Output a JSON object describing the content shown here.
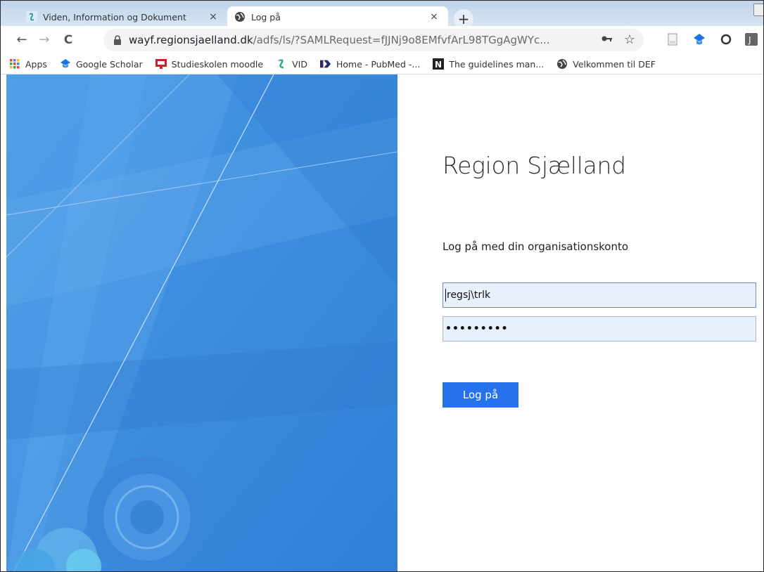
{
  "browser": {
    "tabs": [
      {
        "title": "Viden, Information og Dokument",
        "close": "×",
        "active": false
      },
      {
        "title": "Log på",
        "close": "×",
        "active": true
      }
    ],
    "new_tab": "+",
    "nav": {
      "back": "←",
      "forward": "→",
      "reload": "C"
    },
    "address": {
      "host": "wayf.regionsjaelland.dk",
      "path": "/adfs/ls/?SAMLRequest=fJJNj9o8EMfvfArL98TGgAgWYc..."
    },
    "bookmarks": [
      {
        "label": "Apps",
        "icon": "apps-grid-icon"
      },
      {
        "label": "Google Scholar",
        "icon": "scholar-cap-icon"
      },
      {
        "label": "Studieskolen moodle",
        "icon": "moodle-icon"
      },
      {
        "label": "VID",
        "icon": "vid-icon"
      },
      {
        "label": "Home - PubMed -...",
        "icon": "pubmed-icon"
      },
      {
        "label": "The guidelines man...",
        "icon": "notion-icon"
      },
      {
        "label": "Velkommen til DEF",
        "icon": "globe-icon"
      }
    ]
  },
  "login": {
    "org_name": "Region Sjælland",
    "instruction": "Log på med din organisationskonto",
    "username_value": "regsj\\trlk",
    "password_value": "•••••••••",
    "submit_label": "Log på"
  },
  "colors": {
    "accent": "#2672ec",
    "panel_blue": "#3f8fe0",
    "input_fill": "#e8f0fe"
  }
}
